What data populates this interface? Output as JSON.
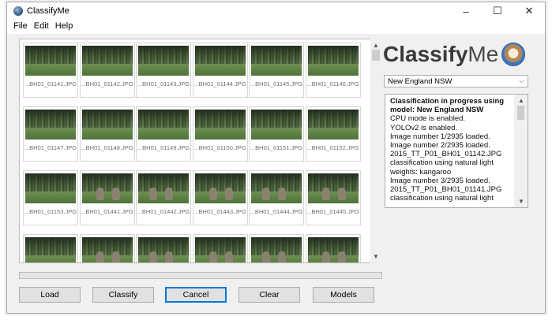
{
  "window": {
    "title": "ClassifyMe",
    "min_glyph": "–",
    "max_glyph": "☐",
    "close_glyph": "✕"
  },
  "menu": [
    "File",
    "Edit",
    "Help"
  ],
  "gallery": {
    "thumbnails": [
      "...BH01_01141.JPG",
      "...BH01_01142.JPG",
      "...BH01_01143.JPG",
      "...BH01_01144.JPG",
      "...BH01_01145.JPG",
      "...BH01_01146.JPG",
      "...BH01_01147.JPG",
      "...BH01_01148.JPG",
      "...BH01_01149.JPG",
      "...BH01_01150.JPG",
      "...BH01_01151.JPG",
      "...BH01_01152.JPG",
      "...BH01_01153.JPG",
      "...BH01_01441.JPG",
      "...BH01_01442.JPG",
      "...BH01_01443.JPG",
      "...BH01_01444.JPG",
      "...BH01_01445.JPG",
      "",
      "",
      "",
      "",
      "",
      ""
    ]
  },
  "buttons": {
    "load": "Load",
    "classify": "Classify",
    "cancel": "Cancel",
    "clear": "Clear",
    "models": "Models"
  },
  "logo": {
    "bold": "Classify",
    "light": "Me"
  },
  "model_select": {
    "value": "New England NSW"
  },
  "log": {
    "lines": [
      {
        "text": "Classification in progress using",
        "bold": true
      },
      {
        "text": "model: New England NSW",
        "bold": true
      },
      {
        "text": "CPU mode is enabled.",
        "bold": false
      },
      {
        "text": "YOLOv2 is enabled.",
        "bold": false
      },
      {
        "text": "Image number 1/2935 loaded.",
        "bold": false
      },
      {
        "text": "Image number 2/2935 loaded.",
        "bold": false
      },
      {
        "text": "2015_TT_P01_BH01_01142.JPG",
        "bold": false
      },
      {
        "text": "classification using natural light",
        "bold": false
      },
      {
        "text": "weights: kangaroo",
        "bold": false
      },
      {
        "text": "Image number 3/2935 loaded.",
        "bold": false
      },
      {
        "text": "2015_TT_P01_BH01_01141.JPG",
        "bold": false
      },
      {
        "text": "classification using natural light",
        "bold": false
      }
    ]
  },
  "icons": {
    "scroll_up": "▲",
    "scroll_down": "▼",
    "dropdown": "⌵"
  }
}
